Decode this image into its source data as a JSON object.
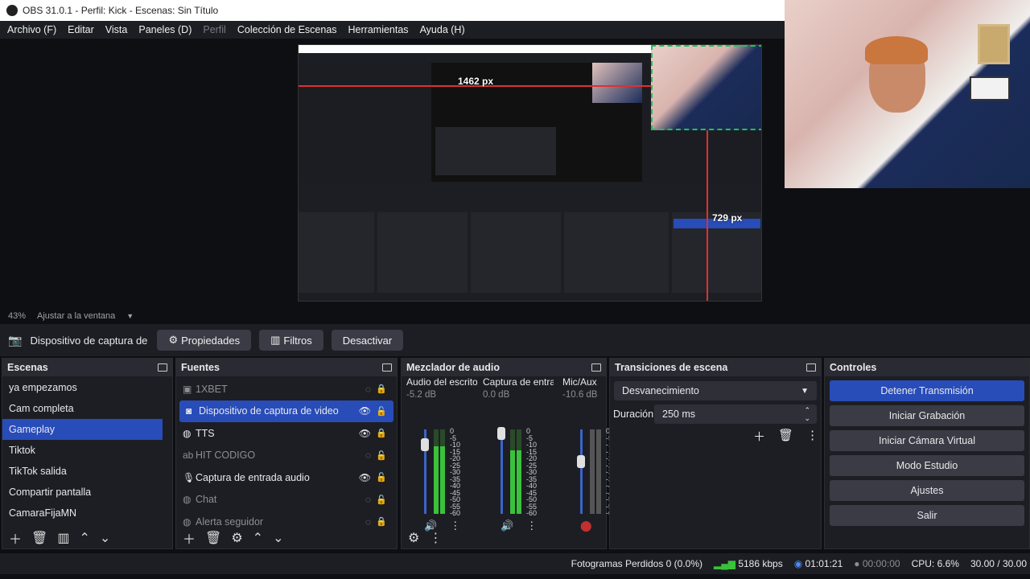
{
  "window": {
    "title": "OBS 31.0.1 - Perfil: Kick - Escenas: Sin Título"
  },
  "menu": [
    "Archivo (F)",
    "Editar",
    "Vista",
    "Paneles (D)",
    "Perfil",
    "Colección de Escenas",
    "Herramientas",
    "Ayuda (H)"
  ],
  "preview": {
    "width_label": "1462 px",
    "height_label": "729 px"
  },
  "zoom": {
    "percent": "43%",
    "mode": "Ajustar a la ventana"
  },
  "source_bar": {
    "source_name": "Dispositivo de captura de v",
    "properties": "Propiedades",
    "filters": "Filtros",
    "deactivate": "Desactivar"
  },
  "scenes": {
    "title": "Escenas",
    "items": [
      "ya empezamos",
      "Cam completa",
      "Gameplay",
      "Tiktok",
      "TikTok salida",
      "Compartir pantalla",
      "CamaraFijaMN"
    ],
    "selected": "Gameplay"
  },
  "sources": {
    "title": "Fuentes",
    "items": [
      {
        "label": "1XBET",
        "icon": "image-icon",
        "visible": false,
        "locked": true
      },
      {
        "label": "Dispositivo de captura de video",
        "icon": "camera-icon",
        "visible": true,
        "locked": false
      },
      {
        "label": "TTS",
        "icon": "browser-icon",
        "visible": true,
        "locked": true
      },
      {
        "label": "HIT CODIGO",
        "icon": "text-icon",
        "visible": false,
        "locked": false
      },
      {
        "label": "Captura de entrada audio",
        "icon": "mic-icon",
        "visible": true,
        "locked": false
      },
      {
        "label": "Chat",
        "icon": "browser-icon",
        "visible": false,
        "locked": false
      },
      {
        "label": "Alerta seguidor",
        "icon": "browser-icon",
        "visible": false,
        "locked": true
      }
    ]
  },
  "mixer": {
    "title": "Mezclador de audio",
    "channels": [
      {
        "name": "Audio del escrito",
        "db": "-5.2 dB",
        "level": 0.8,
        "volume": 0.82
      },
      {
        "name": "Captura de entra",
        "db": "0.0 dB",
        "level": 0.75,
        "volume": 0.95
      },
      {
        "name": "Mic/Aux",
        "db": "-10.6 dB",
        "level": 0.0,
        "volume": 0.62
      }
    ],
    "scale": [
      "0",
      "-5",
      "-10",
      "-15",
      "-20",
      "-25",
      "-30",
      "-35",
      "-40",
      "-45",
      "-50",
      "-55",
      "-60"
    ]
  },
  "transitions": {
    "title": "Transiciones de escena",
    "selected": "Desvanecimiento",
    "duration_label": "Duración",
    "duration_value": "250 ms"
  },
  "controls": {
    "title": "Controles",
    "buttons": [
      "Detener Transmisión",
      "Iniciar Grabación",
      "Iniciar Cámara Virtual",
      "Modo Estudio",
      "Ajustes",
      "Salir"
    ]
  },
  "status": {
    "dropped": "Fotogramas Perdidos 0 (0.0%)",
    "bitrate": "5186 kbps",
    "stream_time": "01:01:21",
    "rec_time": "00:00:00",
    "cpu": "CPU: 6.6%",
    "fps": "30.00 / 30.00"
  },
  "colors": {
    "accent": "#284cb8",
    "panel": "#1d1e24",
    "background": "#0e0f13"
  }
}
